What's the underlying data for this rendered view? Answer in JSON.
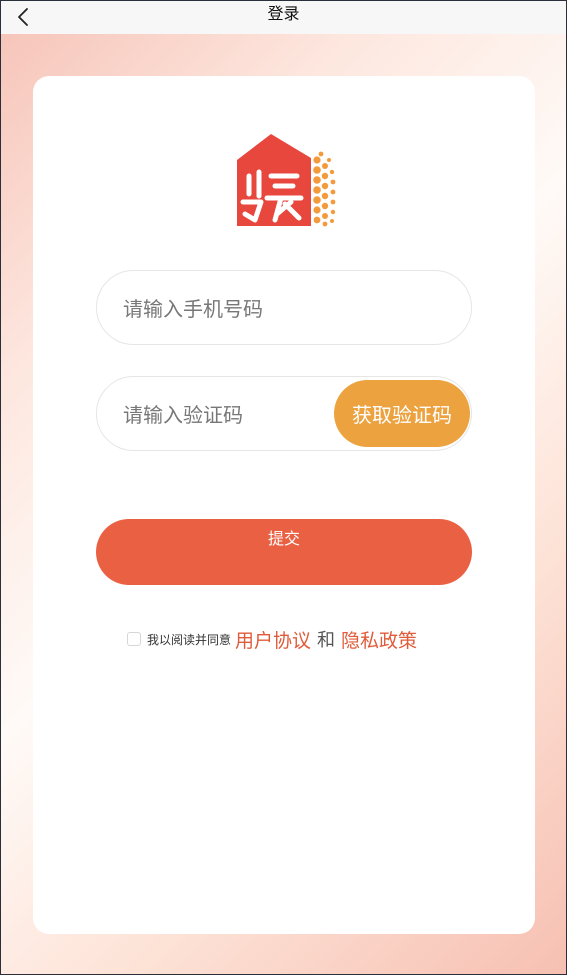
{
  "header": {
    "title": "登录",
    "back_icon": "chevron-left-icon"
  },
  "logo": {
    "icon": "brand-logo-icon",
    "colors": {
      "primary": "#e8473d",
      "dots": "#f39a3c"
    }
  },
  "form": {
    "phone_placeholder": "请输入手机号码",
    "code_placeholder": "请输入验证码",
    "get_code_label": "获取验证码",
    "submit_label": "提交"
  },
  "agreement": {
    "checked": false,
    "prefix": "我以阅读并同意",
    "user_agreement": "用户协议",
    "and": "和",
    "privacy_policy": "隐私政策"
  },
  "colors": {
    "submit": "#ea6043",
    "get_code": "#eda240",
    "link": "#e05b3a"
  }
}
